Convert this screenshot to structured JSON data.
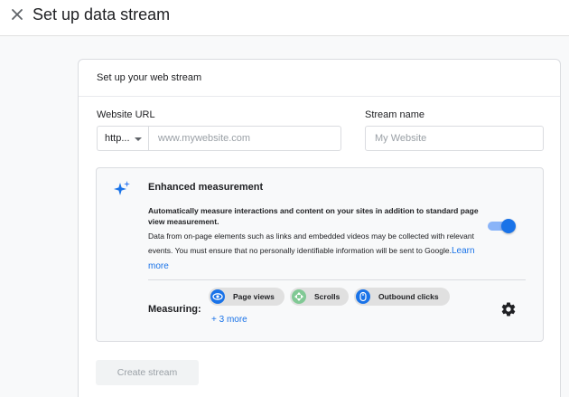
{
  "header": {
    "title": "Set up data stream",
    "close_icon": "close-icon"
  },
  "card": {
    "title": "Set up your web stream",
    "website_url": {
      "label": "Website URL",
      "protocol": "http...",
      "placeholder": "www.mywebsite.com",
      "value": ""
    },
    "stream_name": {
      "label": "Stream name",
      "placeholder": "My Website",
      "value": ""
    },
    "enhanced_measurement": {
      "icon": "sparkle-icon",
      "title": "Enhanced measurement",
      "description_bold": "Automatically measure interactions and content on your sites in addition to standard page view measurement.",
      "description": "Data from on-page elements such as links and embedded videos may be collected with relevant events. You must ensure that no personally identifiable information will be sent to Google.",
      "learn_more": "Learn more",
      "enabled": true,
      "measuring_label": "Measuring:",
      "chips": [
        {
          "label": "Page views",
          "icon": "eye-icon",
          "color": "#1a73e8"
        },
        {
          "label": "Scrolls",
          "icon": "scroll-icon",
          "color": "#81c995"
        },
        {
          "label": "Outbound clicks",
          "icon": "mouse-icon",
          "color": "#1a73e8"
        }
      ],
      "more": "+ 3 more",
      "settings_icon": "gear-icon"
    },
    "create_button": "Create stream"
  },
  "colors": {
    "accent": "#1a73e8",
    "toggle_track": "#8ab4f8",
    "border": "#dadce0",
    "disabled_text": "#9aa0a6"
  }
}
